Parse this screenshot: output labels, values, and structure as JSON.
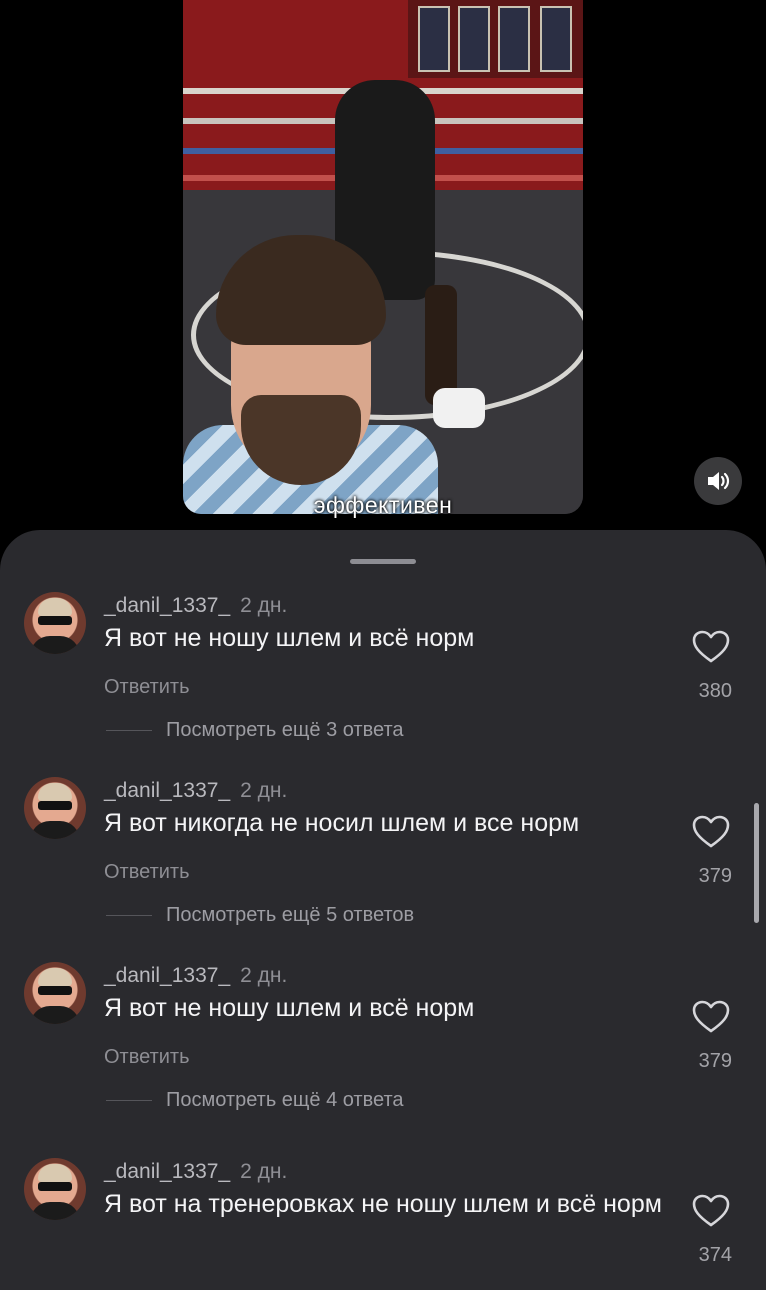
{
  "video": {
    "caption": "эффективен"
  },
  "comments": [
    {
      "username": "_danil_1337_",
      "time": "2 дн.",
      "text": "Я вот не ношу шлем и всё норм",
      "reply_label": "Ответить",
      "likes": "380",
      "more_replies": "Посмотреть ещё 3 ответа"
    },
    {
      "username": "_danil_1337_",
      "time": "2 дн.",
      "text": "Я вот никогда не носил шлем и все норм",
      "reply_label": "Ответить",
      "likes": "379",
      "more_replies": "Посмотреть ещё 5 ответов"
    },
    {
      "username": "_danil_1337_",
      "time": "2 дн.",
      "text": "Я вот не ношу шлем и всё норм",
      "reply_label": "Ответить",
      "likes": "379",
      "more_replies": "Посмотреть ещё 4 ответа"
    },
    {
      "username": "_danil_1337_",
      "time": "2 дн.",
      "text": "Я вот на тренеровках не ношу шлем и всё норм",
      "likes": "374"
    }
  ],
  "icons": {
    "sound": "speaker-icon",
    "like": "heart-icon"
  },
  "colors": {
    "sheet_background": "#2a2a2e",
    "page_background": "#000000"
  }
}
